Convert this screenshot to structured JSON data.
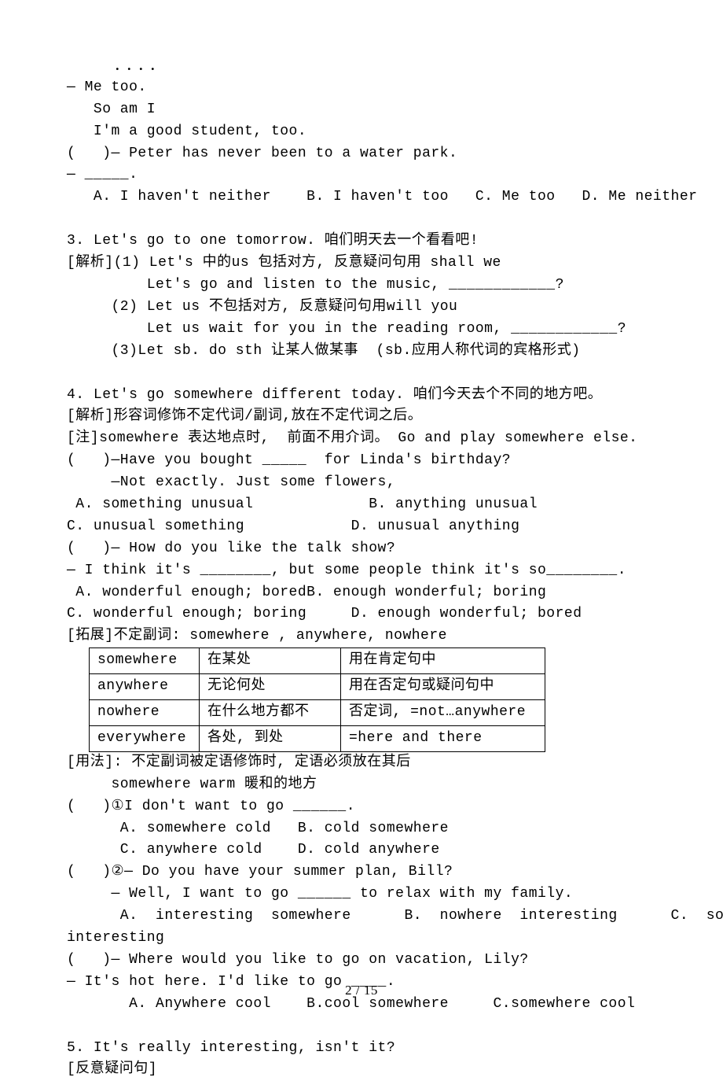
{
  "dots": "．．．．",
  "lines": {
    "l1": "— Me too.",
    "l2": "   So am I",
    "l3": "   I'm a good student, too.",
    "l4": "(   )— Peter has never been to a water park.",
    "l5": "— _____.",
    "l6": "   A. I haven't neither    B. I haven't too   C. Me too   D. Me neither",
    "l7": "3. Let's go to one tomorrow. 咱们明天去一个看看吧!",
    "l8": "[解析](1) Let's 中的us 包括对方, 反意疑问句用 shall we",
    "l9": "         Let's go and listen to the music, ____________?",
    "l10": "     (2) Let us 不包括对方, 反意疑问句用will you",
    "l11": "         Let us wait for you in the reading room, ____________?",
    "l12": "     (3)Let sb. do sth 让某人做某事  (sb.应用人称代词的宾格形式)",
    "l13": "4. Let's go somewhere different today. 咱们今天去个不同的地方吧。",
    "l14": "[解析]形容词修饰不定代词/副词,放在不定代词之后。",
    "l15": "[注]somewhere 表达地点时,  前面不用介词。 Go and play somewhere else.",
    "l16": "(   )—Have you bought _____  for Linda's birthday?",
    "l17": "     —Not exactly. Just some flowers,",
    "l18": " A. something unusual             B. anything unusual",
    "l19": "C. unusual something            D. unusual anything",
    "l20": "(   )— How do you like the talk show?",
    "l21": "— I think it's ________, but some people think it's so________.",
    "l22": " A. wonderful enough; boredB. enough wonderful; boring",
    "l23": "C. wonderful enough; boring     D. enough wonderful; bored",
    "l24": "[拓展]不定副词: somewhere , anywhere, nowhere",
    "l25": "[用法]: 不定副词被定语修饰时, 定语必须放在其后",
    "l26": "     somewhere warm 暖和的地方",
    "l27": "(   )①I don't want to go ______.",
    "l28": "      A. somewhere cold   B. cold somewhere",
    "l29": "      C. anywhere cold    D. cold anywhere",
    "l30": "(   )②— Do you have your summer plan, Bill?",
    "l31": "     — Well, I want to go ______ to relax with my family.",
    "l32": "      A.  interesting  somewhere      B.  nowhere  interesting      C.  somewhere",
    "l33": "interesting",
    "l34": "(   )— Where would you like to go on vacation, Lily?",
    "l35": "— It's hot here. I'd like to go ____.",
    "l36": "       A. Anywhere cool    B.cool somewhere     C.somewhere cool",
    "l37": "5. It's really interesting, isn't it?",
    "l38": "[反意疑问句]"
  },
  "table": {
    "rows": [
      {
        "c1": "somewhere",
        "c2": "在某处",
        "c3": "用在肯定句中"
      },
      {
        "c1": "anywhere",
        "c2": "无论何处",
        "c3": "用在否定句或疑问句中"
      },
      {
        "c1": "nowhere",
        "c2": "在什么地方都不",
        "c3": "否定词, =not…anywhere"
      },
      {
        "c1": "everywhere",
        "c2": "各处, 到处",
        "c3": "=here and there"
      }
    ]
  },
  "footer": "2 / 15"
}
